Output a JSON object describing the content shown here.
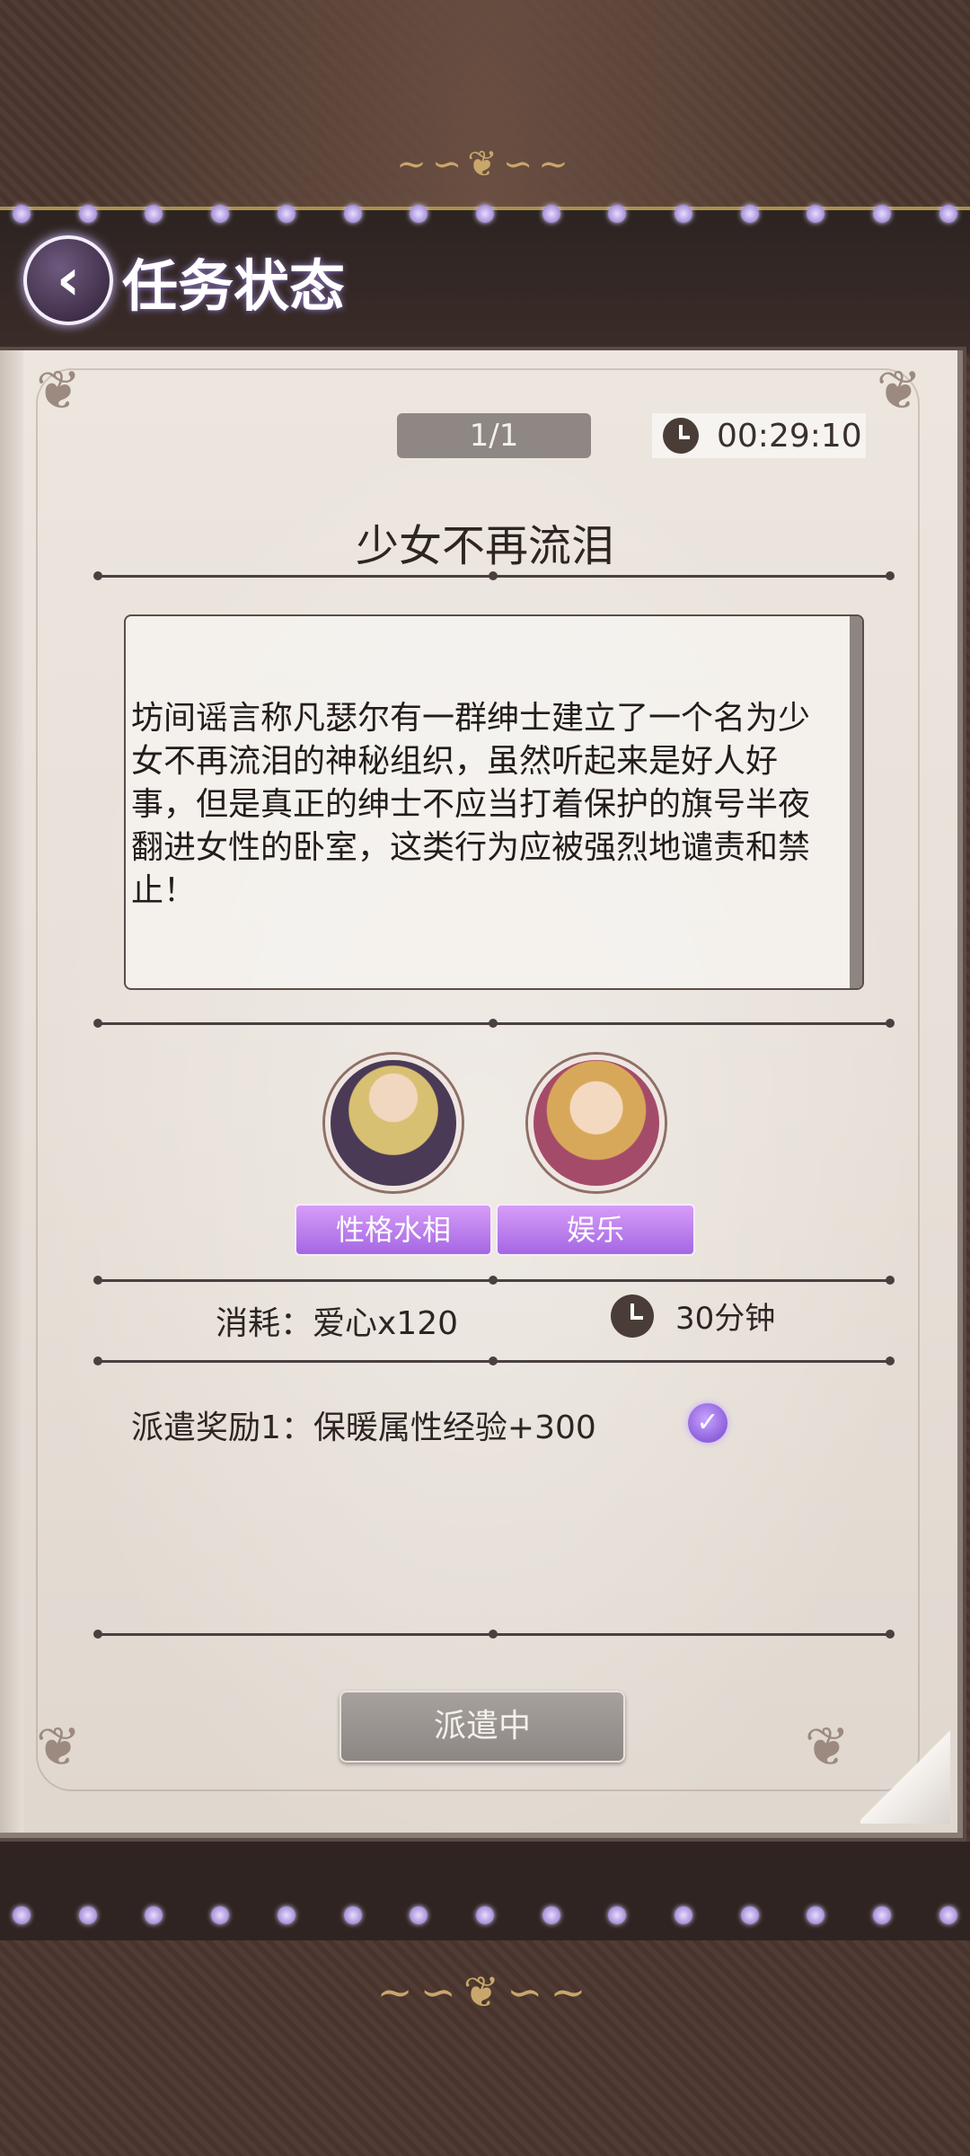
{
  "header": {
    "title": "任务状态",
    "back_icon": "chevron-left-icon"
  },
  "mission": {
    "counter": "1/1",
    "timer": "00:29:10",
    "title": "少女不再流泪",
    "description": "坊间谣言称凡瑟尔有一群绅士建立了一个名为少女不再流泪的神秘组织，虽然听起来是好人好事，但是真正的绅士不应当打着保护的旗号半夜翻进女性的卧室，这类行为应被强烈地谴责和禁止！",
    "tags": [
      "性格水相",
      "娱乐"
    ],
    "cost": "消耗：爱心x120",
    "duration": "30分钟",
    "reward": "派遣奖励1：保暖属性经验+300",
    "action_button": "派遣中"
  },
  "colors": {
    "tag_purple": "#a467e4",
    "button_disabled": "#8d8683",
    "paper": "#e7e0d8"
  }
}
